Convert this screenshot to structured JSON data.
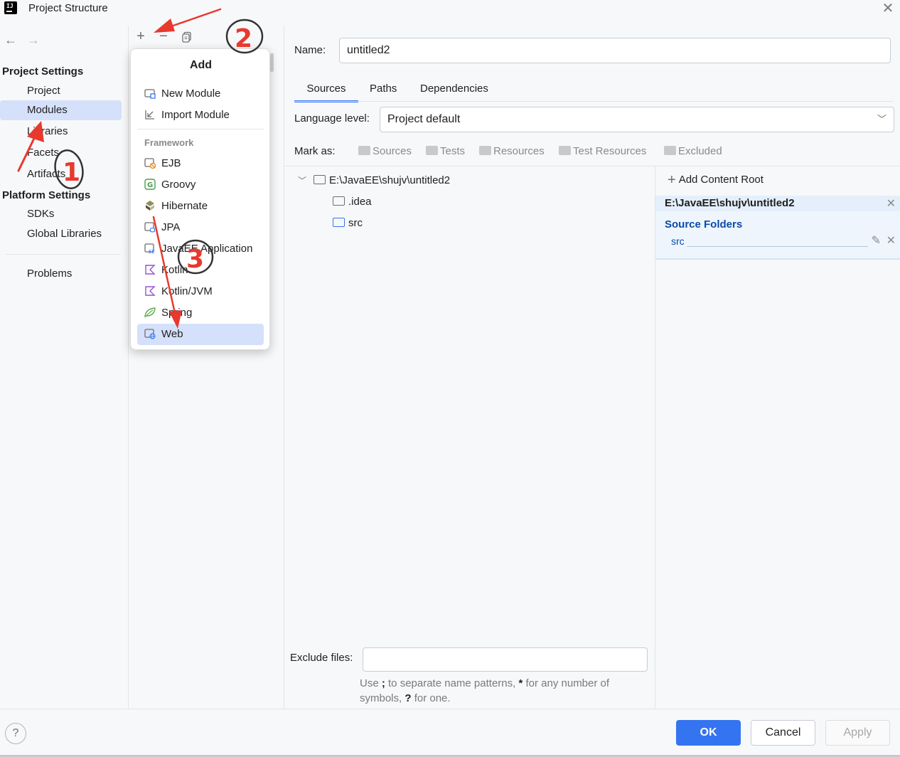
{
  "window": {
    "title": "Project Structure"
  },
  "nav": {
    "back_icon": "arrow-left-icon",
    "forward_icon": "arrow-right-icon",
    "project_settings": "Project Settings",
    "items": [
      "Project",
      "Modules",
      "Libraries",
      "Facets",
      "Artifacts"
    ],
    "platform_settings": "Platform Settings",
    "platform_items": [
      "SDKs",
      "Global Libraries"
    ],
    "problems": "Problems",
    "selected": "Modules"
  },
  "toolbar": {
    "add_icon": "plus-icon",
    "remove_icon": "minus-icon",
    "copy_icon": "copy-icon"
  },
  "popup": {
    "title": "Add",
    "new_module": "New Module",
    "import_module": "Import Module",
    "framework_label": "Framework",
    "frameworks": [
      "EJB",
      "Groovy",
      "Hibernate",
      "JPA",
      "JavaEE Application",
      "Kotlin",
      "Kotlin/JVM",
      "Spring",
      "Web"
    ],
    "selected": "Web"
  },
  "module": {
    "name_label": "Name:",
    "name_value": "untitled2",
    "tabs": [
      "Sources",
      "Paths",
      "Dependencies"
    ],
    "active_tab": "Sources",
    "language_level_label": "Language level:",
    "language_level_value": "Project default",
    "mark_as_label": "Mark as:",
    "mark_as": [
      "Sources",
      "Tests",
      "Resources",
      "Test Resources",
      "Excluded"
    ]
  },
  "tree": {
    "root": "E:\\JavaEE\\shujv\\untitled2",
    "children": [
      ".idea",
      "src"
    ]
  },
  "content_roots": {
    "add_label": "Add Content Root",
    "root_path": "E:\\JavaEE\\shujv\\untitled2",
    "source_folders_title": "Source Folders",
    "source_folder": "src"
  },
  "exclude": {
    "label": "Exclude files:",
    "value": "",
    "hint_parts": [
      "Use ",
      ";",
      " to separate name patterns, ",
      "*",
      " for any number of symbols, ",
      "?",
      " for one."
    ]
  },
  "buttons": {
    "help": "?",
    "ok": "OK",
    "cancel": "Cancel",
    "apply": "Apply"
  },
  "annotations": {
    "markers": [
      "1",
      "2",
      "3"
    ],
    "color": "#e8392e"
  },
  "colors": {
    "accent": "#3574f0",
    "selection": "#d5e1fa",
    "source_blue": "#0a4ba8"
  }
}
